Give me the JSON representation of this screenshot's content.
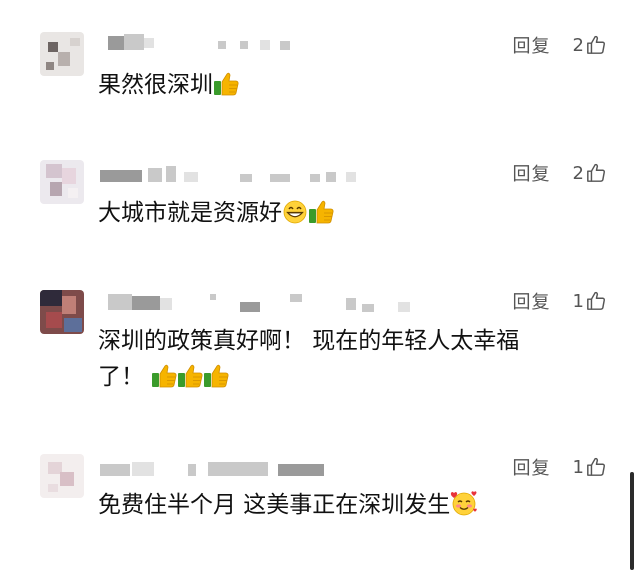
{
  "colors": {
    "background": "#ffffff",
    "text": "#111111",
    "meta": "#555555",
    "thumb_yellow": "#f6b400",
    "thumb_green": "#3a9b2b"
  },
  "reply_label": "回复",
  "comments": [
    {
      "likes": "2",
      "text": "果然很深圳",
      "emojis": [
        "thumbs-up"
      ]
    },
    {
      "likes": "2",
      "text": "大城市就是资源好",
      "emojis": [
        "grinning-face",
        "thumbs-up"
      ]
    },
    {
      "likes": "1",
      "text_line1": "深圳的政策真好啊！ 现在的年轻人太幸福",
      "text_line2": "了！",
      "emojis": [
        "thumbs-up",
        "thumbs-up",
        "thumbs-up"
      ]
    },
    {
      "likes": "1",
      "text": "免费住半个月 这美事正在深圳发生",
      "emojis": [
        "smiling-face-with-hearts"
      ]
    }
  ]
}
